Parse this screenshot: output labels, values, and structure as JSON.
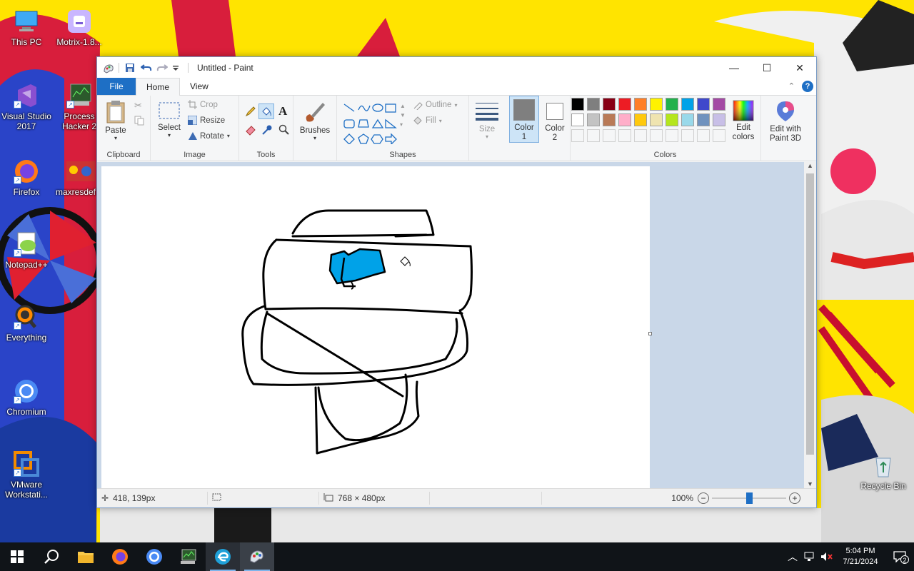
{
  "desktop": {
    "icons": [
      {
        "label": "This PC",
        "icon": "computer-icon"
      },
      {
        "label": "Motrix-1.8...",
        "icon": "motrix-icon"
      },
      {
        "label": "Visual Studio 2017",
        "icon": "visual-studio-icon"
      },
      {
        "label": "Process Hacker 2",
        "icon": "process-hacker-icon"
      },
      {
        "label": "Firefox",
        "icon": "firefox-icon"
      },
      {
        "label": "maxresdef...",
        "icon": "image-file-icon"
      },
      {
        "label": "Notepad++",
        "icon": "notepadpp-icon"
      },
      {
        "label": "Everything",
        "icon": "everything-icon"
      },
      {
        "label": "Chromium",
        "icon": "chromium-icon"
      },
      {
        "label": "VMware Workstati...",
        "icon": "vmware-icon"
      },
      {
        "label": "Recycle Bin",
        "icon": "recycle-bin-icon"
      }
    ]
  },
  "window": {
    "title": "Untitled - Paint",
    "controls": {
      "minimize": "—",
      "maximize": "☐",
      "close": "✕"
    }
  },
  "tabs": {
    "file": "File",
    "home": "Home",
    "view": "View"
  },
  "ribbon": {
    "clipboard": {
      "label": "Clipboard",
      "paste": "Paste"
    },
    "image": {
      "label": "Image",
      "select": "Select",
      "crop": "Crop",
      "resize": "Resize",
      "rotate": "Rotate"
    },
    "tools": {
      "label": "Tools"
    },
    "brushes": {
      "label": "Brushes"
    },
    "shapes": {
      "label": "Shapes",
      "outline": "Outline",
      "fill": "Fill"
    },
    "size": {
      "label": "Size"
    },
    "color1": {
      "label": "Color 1",
      "value": "#7f7f7f"
    },
    "color2": {
      "label": "Color 2",
      "value": "#ffffff"
    },
    "colors": {
      "label": "Colors",
      "palette_row1": [
        "#000000",
        "#7f7f7f",
        "#880015",
        "#ed1c24",
        "#ff7f27",
        "#fff200",
        "#22b14c",
        "#00a2e8",
        "#3f48cc",
        "#a349a4"
      ],
      "palette_row2": [
        "#ffffff",
        "#c3c3c3",
        "#b97a57",
        "#ffaec9",
        "#ffc90e",
        "#efe4b0",
        "#b5e61d",
        "#99d9ea",
        "#7092be",
        "#c8bfe7"
      ],
      "edit_colors": "Edit colors"
    },
    "paint3d": {
      "label": "Edit with Paint 3D"
    }
  },
  "status": {
    "cursor_pos": "418, 139px",
    "canvas_size": "768 × 480px",
    "zoom": "100%",
    "zoom_level": 0.5
  },
  "taskbar": {
    "apps": [
      "start-icon",
      "search-icon",
      "file-explorer-icon",
      "firefox-icon",
      "chromium-icon",
      "process-hacker-icon",
      "edge-icon",
      "paint-icon"
    ],
    "time": "5:04 PM",
    "date": "7/21/2024",
    "notifications": "2"
  }
}
